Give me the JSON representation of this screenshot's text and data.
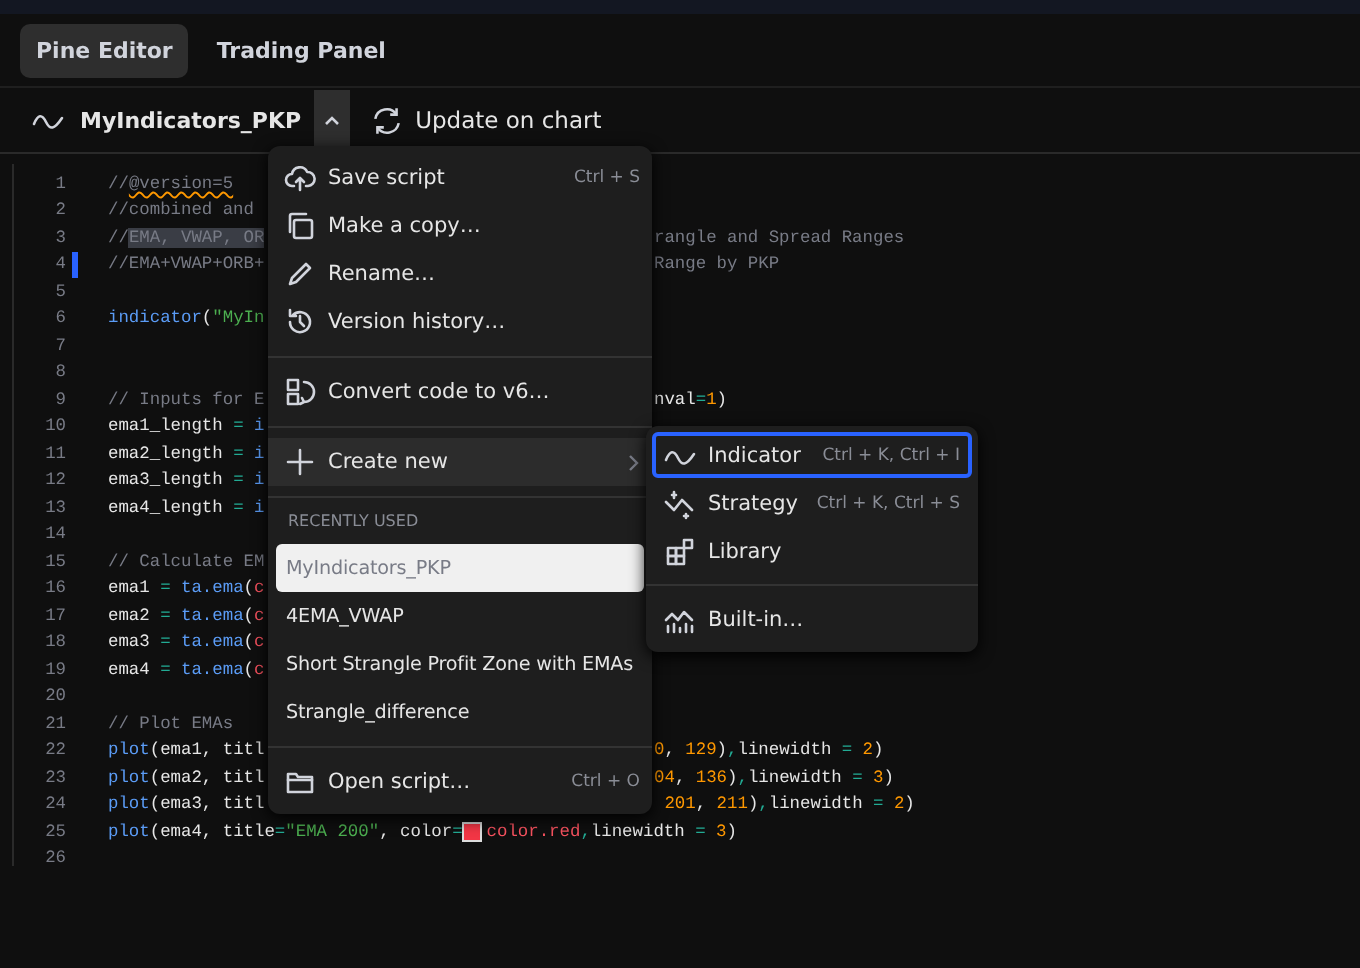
{
  "tabs": [
    {
      "label": "Pine Editor",
      "selected": true
    },
    {
      "label": "Trading Panel",
      "selected": false
    }
  ],
  "toolbar": {
    "script_name": "MyIndicators_PKP",
    "update_label": "Update on chart"
  },
  "editor": {
    "lines": [
      {
        "number": "1",
        "changed": false,
        "left": [
          {
            "t": "//",
            "kind": "comment"
          },
          {
            "t": "@version=5",
            "kind": "warning"
          }
        ]
      },
      {
        "number": "2",
        "changed": false,
        "left": [
          {
            "t": "//combined and",
            "kind": "comment"
          }
        ]
      },
      {
        "number": "3",
        "changed": false,
        "left": [
          {
            "t": "//",
            "kind": "comment"
          },
          {
            "t": "EMA, VWAP, OR",
            "kind": "selection"
          }
        ],
        "right": [
          {
            "t": "rangle and Spread Ranges",
            "kind": "comment"
          }
        ]
      },
      {
        "number": "4",
        "changed": true,
        "left": [
          {
            "t": "//EMA+VWAP+ORB+",
            "kind": "comment"
          }
        ],
        "right": [
          {
            "t": "Range by PKP",
            "kind": "comment"
          }
        ]
      },
      {
        "number": "5",
        "changed": false
      },
      {
        "number": "6",
        "changed": false,
        "left": [
          {
            "t": "indicator",
            "kind": "function"
          },
          {
            "t": "(",
            "kind": "plain"
          },
          {
            "t": "\"MyIn",
            "kind": "string"
          }
        ]
      },
      {
        "number": "7",
        "changed": false
      },
      {
        "number": "8",
        "changed": false
      },
      {
        "number": "9",
        "changed": false,
        "left": [
          {
            "t": "// Inputs for E",
            "kind": "comment"
          }
        ],
        "right": [
          {
            "t": "nval",
            "kind": "plain"
          },
          {
            "t": "=",
            "kind": "operator"
          },
          {
            "t": "1",
            "kind": "number"
          },
          {
            "t": ")",
            "kind": "plain"
          }
        ]
      },
      {
        "number": "10",
        "changed": false,
        "left": [
          {
            "t": "ema1_length ",
            "kind": "plain"
          },
          {
            "t": "=",
            "kind": "operator"
          },
          {
            "t": " i",
            "kind": "function"
          }
        ]
      },
      {
        "number": "11",
        "changed": false,
        "left": [
          {
            "t": "ema2_length ",
            "kind": "plain"
          },
          {
            "t": "=",
            "kind": "operator"
          },
          {
            "t": " i",
            "kind": "function"
          }
        ]
      },
      {
        "number": "12",
        "changed": false,
        "left": [
          {
            "t": "ema3_length ",
            "kind": "plain"
          },
          {
            "t": "=",
            "kind": "operator"
          },
          {
            "t": " i",
            "kind": "function"
          }
        ]
      },
      {
        "number": "13",
        "changed": false,
        "left": [
          {
            "t": "ema4_length ",
            "kind": "plain"
          },
          {
            "t": "=",
            "kind": "operator"
          },
          {
            "t": " i",
            "kind": "function"
          }
        ]
      },
      {
        "number": "14",
        "changed": false
      },
      {
        "number": "15",
        "changed": false,
        "left": [
          {
            "t": "// Calculate EM",
            "kind": "comment"
          }
        ]
      },
      {
        "number": "16",
        "changed": false,
        "left": [
          {
            "t": "ema1 ",
            "kind": "plain"
          },
          {
            "t": "=",
            "kind": "operator"
          },
          {
            "t": " ta.ema",
            "kind": "function"
          },
          {
            "t": "(",
            "kind": "plain"
          },
          {
            "t": "c",
            "kind": "variable"
          }
        ]
      },
      {
        "number": "17",
        "changed": false,
        "left": [
          {
            "t": "ema2 ",
            "kind": "plain"
          },
          {
            "t": "=",
            "kind": "operator"
          },
          {
            "t": " ta.ema",
            "kind": "function"
          },
          {
            "t": "(",
            "kind": "plain"
          },
          {
            "t": "c",
            "kind": "variable"
          }
        ]
      },
      {
        "number": "18",
        "changed": false,
        "left": [
          {
            "t": "ema3 ",
            "kind": "plain"
          },
          {
            "t": "=",
            "kind": "operator"
          },
          {
            "t": " ta.ema",
            "kind": "function"
          },
          {
            "t": "(",
            "kind": "plain"
          },
          {
            "t": "c",
            "kind": "variable"
          }
        ]
      },
      {
        "number": "19",
        "changed": false,
        "left": [
          {
            "t": "ema4 ",
            "kind": "plain"
          },
          {
            "t": "=",
            "kind": "operator"
          },
          {
            "t": " ta.ema",
            "kind": "function"
          },
          {
            "t": "(",
            "kind": "plain"
          },
          {
            "t": "c",
            "kind": "variable"
          }
        ]
      },
      {
        "number": "20",
        "changed": false
      },
      {
        "number": "21",
        "changed": false,
        "left": [
          {
            "t": "// Plot EMAs",
            "kind": "comment"
          }
        ]
      },
      {
        "number": "22",
        "changed": false,
        "left": [
          {
            "t": "plot",
            "kind": "function"
          },
          {
            "t": "(ema1, titl",
            "kind": "plain"
          }
        ],
        "right": [
          {
            "t": "0",
            "kind": "number"
          },
          {
            "t": ", ",
            "kind": "plain"
          },
          {
            "t": "129",
            "kind": "number"
          },
          {
            "t": ")",
            "kind": "plain"
          },
          {
            "t": ",",
            "kind": "operator"
          },
          {
            "t": "linewidth ",
            "kind": "plain"
          },
          {
            "t": "=",
            "kind": "operator"
          },
          {
            "t": " 2",
            "kind": "number"
          },
          {
            "t": ")",
            "kind": "plain"
          }
        ]
      },
      {
        "number": "23",
        "changed": false,
        "left": [
          {
            "t": "plot",
            "kind": "function"
          },
          {
            "t": "(ema2, titl",
            "kind": "plain"
          }
        ],
        "right": [
          {
            "t": "04",
            "kind": "number"
          },
          {
            "t": ", ",
            "kind": "plain"
          },
          {
            "t": "136",
            "kind": "number"
          },
          {
            "t": ")",
            "kind": "plain"
          },
          {
            "t": ",",
            "kind": "operator"
          },
          {
            "t": "linewidth ",
            "kind": "plain"
          },
          {
            "t": "=",
            "kind": "operator"
          },
          {
            "t": " 3",
            "kind": "number"
          },
          {
            "t": ")",
            "kind": "plain"
          }
        ]
      },
      {
        "number": "24",
        "changed": false,
        "left": [
          {
            "t": "plot",
            "kind": "function"
          },
          {
            "t": "(ema3, titl",
            "kind": "plain"
          }
        ],
        "right": [
          {
            "t": " 201",
            "kind": "number"
          },
          {
            "t": ", ",
            "kind": "plain"
          },
          {
            "t": "211",
            "kind": "number"
          },
          {
            "t": ")",
            "kind": "plain"
          },
          {
            "t": ",",
            "kind": "operator"
          },
          {
            "t": "linewidth ",
            "kind": "plain"
          },
          {
            "t": "=",
            "kind": "operator"
          },
          {
            "t": " 2",
            "kind": "number"
          },
          {
            "t": ")",
            "kind": "plain"
          }
        ]
      },
      {
        "number": "25",
        "changed": false,
        "left": [
          {
            "t": "plot",
            "kind": "function"
          },
          {
            "t": "(ema4, title",
            "kind": "plain"
          },
          {
            "t": "=",
            "kind": "operator"
          },
          {
            "t": "\"EMA 200\"",
            "kind": "string"
          },
          {
            "t": ", color",
            "kind": "plain"
          },
          {
            "t": "=",
            "kind": "operator"
          },
          {
            "kind": "swatch"
          },
          {
            "t": "color.red",
            "kind": "variable"
          },
          {
            "t": ",",
            "kind": "operator"
          },
          {
            "t": "linewidth ",
            "kind": "plain"
          },
          {
            "t": "=",
            "kind": "operator"
          },
          {
            "t": " 3",
            "kind": "number"
          },
          {
            "t": ")",
            "kind": "plain"
          }
        ]
      },
      {
        "number": "26",
        "changed": false
      }
    ]
  },
  "menu": {
    "items": [
      {
        "kind": "action",
        "label": "Save script",
        "shortcut": "Ctrl + S"
      },
      {
        "kind": "action",
        "label": "Make a copy…"
      },
      {
        "kind": "action",
        "label": "Rename…"
      },
      {
        "kind": "action",
        "label": "Version history…"
      },
      {
        "kind": "divider"
      },
      {
        "kind": "action",
        "label": "Convert code to v6…"
      },
      {
        "kind": "divider"
      },
      {
        "kind": "submenu",
        "label": "Create new",
        "expanded": true
      },
      {
        "kind": "divider"
      },
      {
        "kind": "header",
        "label": "RECENTLY USED"
      },
      {
        "kind": "recent",
        "label": "MyIndicators_PKP",
        "selected": true
      },
      {
        "kind": "recent",
        "label": "4EMA_VWAP",
        "selected": false
      },
      {
        "kind": "recent",
        "label": "Short Strangle Profit Zone with EMAs",
        "selected": false
      },
      {
        "kind": "recent",
        "label": "Strangle_difference",
        "selected": false
      },
      {
        "kind": "divider"
      },
      {
        "kind": "action",
        "label": "Open script…",
        "shortcut": "Ctrl + O"
      }
    ]
  },
  "submenu": {
    "items": [
      {
        "kind": "item",
        "label": "Indicator",
        "shortcut": "Ctrl + K, Ctrl + I",
        "selected": true
      },
      {
        "kind": "item",
        "label": "Strategy",
        "shortcut": "Ctrl + K, Ctrl + S",
        "selected": false
      },
      {
        "kind": "item",
        "label": "Library",
        "selected": false
      },
      {
        "kind": "divider"
      },
      {
        "kind": "item",
        "label": "Built-in…",
        "selected": false
      }
    ]
  }
}
